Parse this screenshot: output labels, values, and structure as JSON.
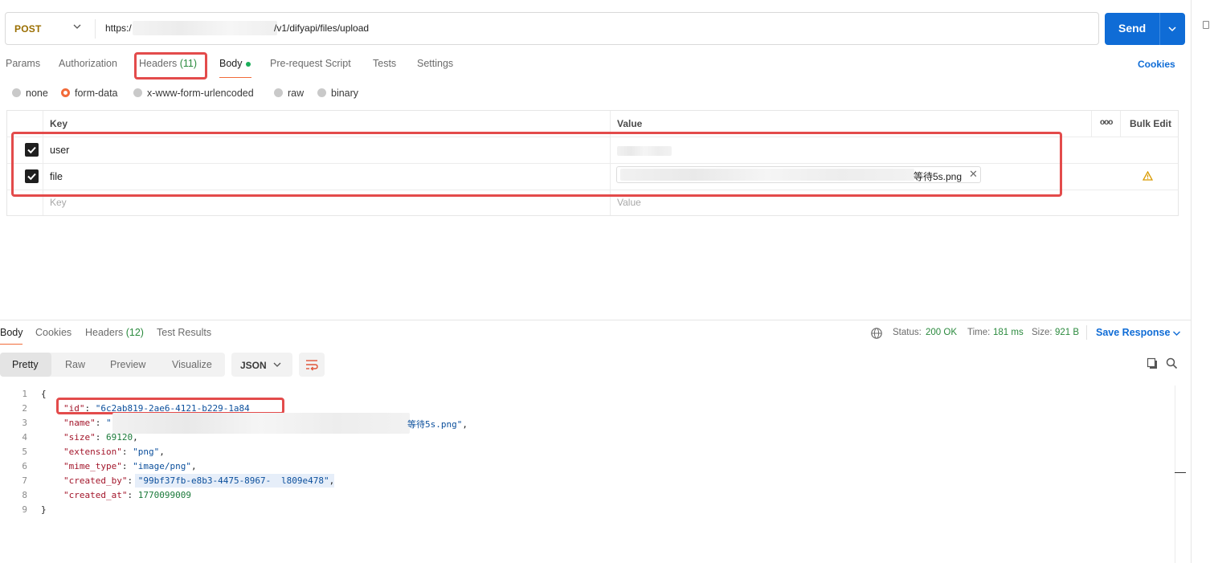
{
  "request": {
    "method": "POST",
    "url_prefix": "https:/",
    "url_suffix": "/v1/difyapi/files/upload",
    "send_label": "Send"
  },
  "request_tabs": {
    "params": "Params",
    "authorization": "Authorization",
    "headers": "Headers",
    "headers_count": "(11)",
    "body": "Body",
    "prerequest": "Pre-request Script",
    "tests": "Tests",
    "settings": "Settings",
    "cookies": "Cookies"
  },
  "body_types": {
    "selected": "form-data",
    "options": [
      "none",
      "form-data",
      "x-www-form-urlencoded",
      "raw",
      "binary"
    ]
  },
  "form_table": {
    "col_key": "Key",
    "col_value": "Value",
    "more": "ooo",
    "bulk_edit": "Bulk Edit",
    "rows": [
      {
        "checked": true,
        "key": "user",
        "value": ""
      },
      {
        "checked": true,
        "key": "file",
        "value": "等待5s.png"
      }
    ],
    "key_placeholder": "Key",
    "value_placeholder": "Value"
  },
  "response_tabs": {
    "body": "Body",
    "cookies": "Cookies",
    "headers": "Headers",
    "headers_count": "(12)",
    "test_results": "Test Results"
  },
  "response_status": {
    "status_label": "Status:",
    "status_value": "200 OK",
    "time_label": "Time:",
    "time_value": "181 ms",
    "size_label": "Size:",
    "size_value": "921 B",
    "save_response": "Save Response"
  },
  "view_modes": {
    "pretty": "Pretty",
    "raw": "Raw",
    "preview": "Preview",
    "visualize": "Visualize",
    "format": "JSON"
  },
  "response_json": {
    "open_brace": "{",
    "close_brace": "}",
    "lines": [
      {
        "no": "1"
      },
      {
        "no": "2",
        "key": "\"id\"",
        "value": "\"6c2ab819-2ae6-4121-b229-1a84"
      },
      {
        "no": "3",
        "key": "\"name\"",
        "value_start": "\"",
        "value_end": "等待5s.png\""
      },
      {
        "no": "4",
        "key": "\"size\"",
        "value": "69120"
      },
      {
        "no": "5",
        "key": "\"extension\"",
        "value": "\"png\""
      },
      {
        "no": "6",
        "key": "\"mime_type\"",
        "value": "\"image/png\""
      },
      {
        "no": "7",
        "key": "\"created_by\"",
        "value_start": "\"99bf37fb-e8b3-4475-8967-",
        "value_end": "l809e478\""
      },
      {
        "no": "8",
        "key": "\"created_at\"",
        "value": "1770099009"
      },
      {
        "no": "9"
      }
    ]
  },
  "colors": {
    "accent": "#0f6cd6",
    "method": "#9a6e00",
    "highlight": "#e34b4b",
    "active_tab": "#f26b3a",
    "status_ok": "#2b8a3e"
  },
  "icons": [
    "chevron-down-icon",
    "globe-icon",
    "copy-icon",
    "search-icon",
    "wrap-lines-icon",
    "warning-icon",
    "close-icon",
    "checkbox-icon"
  ]
}
